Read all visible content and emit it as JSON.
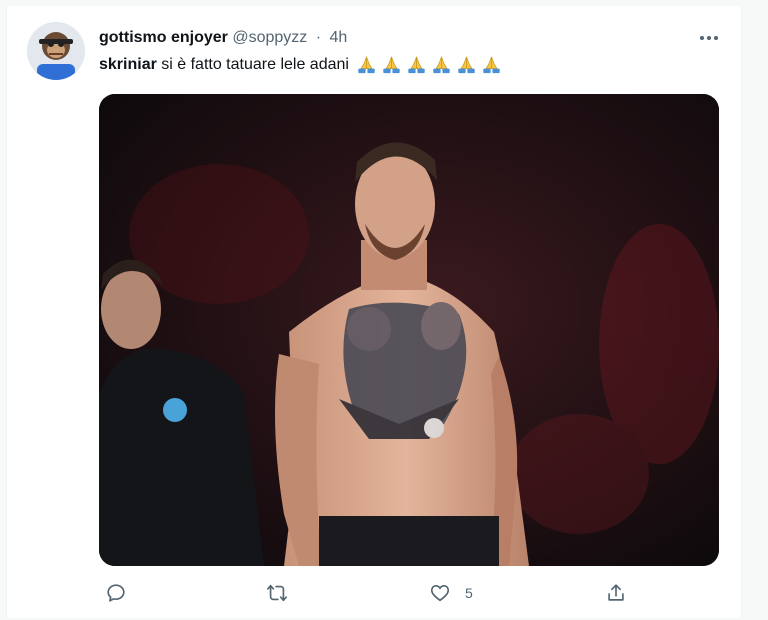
{
  "tweet": {
    "display_name": "gottismo enjoyer",
    "handle": "@soppyzz",
    "separator": "·",
    "time": "4h",
    "text_bold": "skriniar",
    "text_rest": " si è fatto tatuare lele adani",
    "emoji": "folded-hands",
    "emoji_count": 6
  },
  "actions": {
    "reply": {
      "icon": "reply-icon",
      "count": ""
    },
    "retweet": {
      "icon": "retweet-icon",
      "count": ""
    },
    "like": {
      "icon": "heart-icon",
      "count": "5"
    },
    "share": {
      "icon": "share-icon",
      "count": ""
    }
  },
  "colors": {
    "text_primary": "#0f1419",
    "text_secondary": "#536471",
    "background": "#ffffff",
    "emoji_fill": "#f6c544",
    "sleeve": "#4a90d9"
  }
}
